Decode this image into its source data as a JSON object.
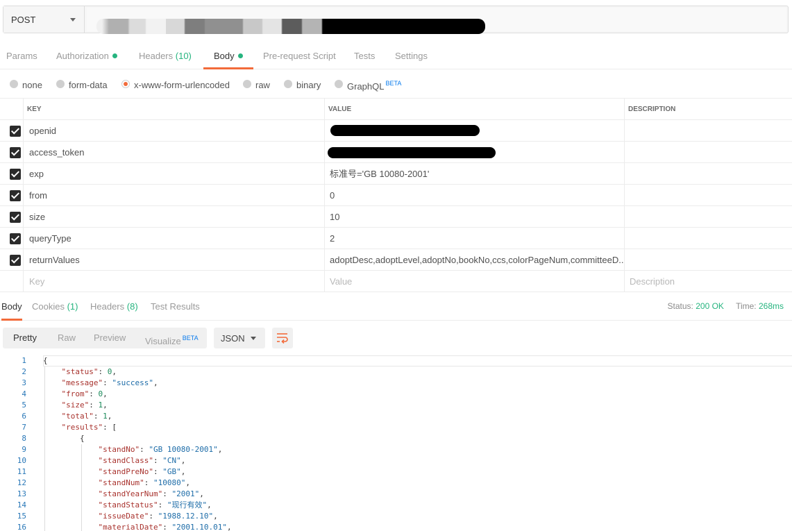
{
  "request": {
    "method": "POST",
    "url": ""
  },
  "request_tabs": [
    {
      "label": "Params",
      "count": "",
      "dot": false,
      "active": false
    },
    {
      "label": "Authorization",
      "count": "",
      "dot": true,
      "active": false
    },
    {
      "label": "Headers",
      "count": "(10)",
      "dot": false,
      "active": false
    },
    {
      "label": "Body",
      "count": "",
      "dot": true,
      "active": true
    },
    {
      "label": "Pre-request Script",
      "count": "",
      "dot": false,
      "active": false
    },
    {
      "label": "Tests",
      "count": "",
      "dot": false,
      "active": false
    },
    {
      "label": "Settings",
      "count": "",
      "dot": false,
      "active": false
    }
  ],
  "body_types": [
    {
      "label": "none",
      "selected": false
    },
    {
      "label": "form-data",
      "selected": false
    },
    {
      "label": "x-www-form-urlencoded",
      "selected": true
    },
    {
      "label": "raw",
      "selected": false
    },
    {
      "label": "binary",
      "selected": false
    },
    {
      "label": "GraphQL",
      "selected": false,
      "badge": "BETA"
    }
  ],
  "params_table": {
    "headers": {
      "key": "KEY",
      "value": "VALUE",
      "description": "DESCRIPTION"
    },
    "rows": [
      {
        "checked": true,
        "key": "openid",
        "value": "",
        "redacted": true,
        "description": ""
      },
      {
        "checked": true,
        "key": "access_token",
        "value": "",
        "redacted": true,
        "description": ""
      },
      {
        "checked": true,
        "key": "exp",
        "value": "标准号='GB 10080-2001'",
        "redacted": false,
        "description": ""
      },
      {
        "checked": true,
        "key": "from",
        "value": "0",
        "redacted": false,
        "description": ""
      },
      {
        "checked": true,
        "key": "size",
        "value": "10",
        "redacted": false,
        "description": ""
      },
      {
        "checked": true,
        "key": "queryType",
        "value": "2",
        "redacted": false,
        "description": ""
      },
      {
        "checked": true,
        "key": "returnValues",
        "value": "adoptDesc,adoptLevel,adoptNo,bookNo,ccs,colorPageNum,committeeD...",
        "redacted": false,
        "description": ""
      }
    ],
    "placeholders": {
      "key": "Key",
      "value": "Value",
      "description": "Description"
    }
  },
  "response_tabs": [
    {
      "label": "Body",
      "count": "",
      "active": true
    },
    {
      "label": "Cookies",
      "count": "(1)",
      "active": false
    },
    {
      "label": "Headers",
      "count": "(8)",
      "active": false
    },
    {
      "label": "Test Results",
      "count": "",
      "active": false
    }
  ],
  "response_status": {
    "status_label": "Status:",
    "status_value": "200 OK",
    "time_label": "Time:",
    "time_value": "268ms"
  },
  "view_modes": [
    {
      "label": "Pretty",
      "active": true,
      "badge": ""
    },
    {
      "label": "Raw",
      "active": false,
      "badge": ""
    },
    {
      "label": "Preview",
      "active": false,
      "badge": ""
    },
    {
      "label": "Visualize",
      "active": false,
      "badge": "BETA"
    }
  ],
  "format": "JSON",
  "icons": {
    "wrap": "wrap-lines-icon",
    "checkbox": "check-icon",
    "dropdown": "chevron-down-icon"
  },
  "colors": {
    "accent": "#f26b3a",
    "green": "#26b47f",
    "beta": "#097bed"
  },
  "response_lines": [
    {
      "n": "1",
      "indent": 0,
      "key": "",
      "value": "",
      "vtype": "",
      "open": "{",
      "trail": ""
    },
    {
      "n": "2",
      "indent": 1,
      "key": "status",
      "value": "0",
      "vtype": "n",
      "open": "",
      "trail": ","
    },
    {
      "n": "3",
      "indent": 1,
      "key": "message",
      "value": "success",
      "vtype": "s",
      "open": "",
      "trail": ","
    },
    {
      "n": "4",
      "indent": 1,
      "key": "from",
      "value": "0",
      "vtype": "n",
      "open": "",
      "trail": ","
    },
    {
      "n": "5",
      "indent": 1,
      "key": "size",
      "value": "1",
      "vtype": "n",
      "open": "",
      "trail": ","
    },
    {
      "n": "6",
      "indent": 1,
      "key": "total",
      "value": "1",
      "vtype": "n",
      "open": "",
      "trail": ","
    },
    {
      "n": "7",
      "indent": 1,
      "key": "results",
      "value": "",
      "vtype": "",
      "open": "[",
      "trail": ""
    },
    {
      "n": "8",
      "indent": 2,
      "key": "",
      "value": "",
      "vtype": "",
      "open": "{",
      "trail": ""
    },
    {
      "n": "9",
      "indent": 3,
      "key": "standNo",
      "value": "GB 10080-2001",
      "vtype": "s",
      "open": "",
      "trail": ","
    },
    {
      "n": "10",
      "indent": 3,
      "key": "standClass",
      "value": "CN",
      "vtype": "s",
      "open": "",
      "trail": ","
    },
    {
      "n": "11",
      "indent": 3,
      "key": "standPreNo",
      "value": "GB",
      "vtype": "s",
      "open": "",
      "trail": ","
    },
    {
      "n": "12",
      "indent": 3,
      "key": "standNum",
      "value": "10080",
      "vtype": "s",
      "open": "",
      "trail": ","
    },
    {
      "n": "13",
      "indent": 3,
      "key": "standYearNum",
      "value": "2001",
      "vtype": "s",
      "open": "",
      "trail": ","
    },
    {
      "n": "14",
      "indent": 3,
      "key": "standStatus",
      "value": "现行有效",
      "vtype": "s",
      "open": "",
      "trail": ","
    },
    {
      "n": "15",
      "indent": 3,
      "key": "issueDate",
      "value": "1988.12.10",
      "vtype": "s",
      "open": "",
      "trail": ","
    },
    {
      "n": "16",
      "indent": 3,
      "key": "materialDate",
      "value": "2001.10.01",
      "vtype": "s",
      "open": "",
      "trail": ","
    }
  ]
}
